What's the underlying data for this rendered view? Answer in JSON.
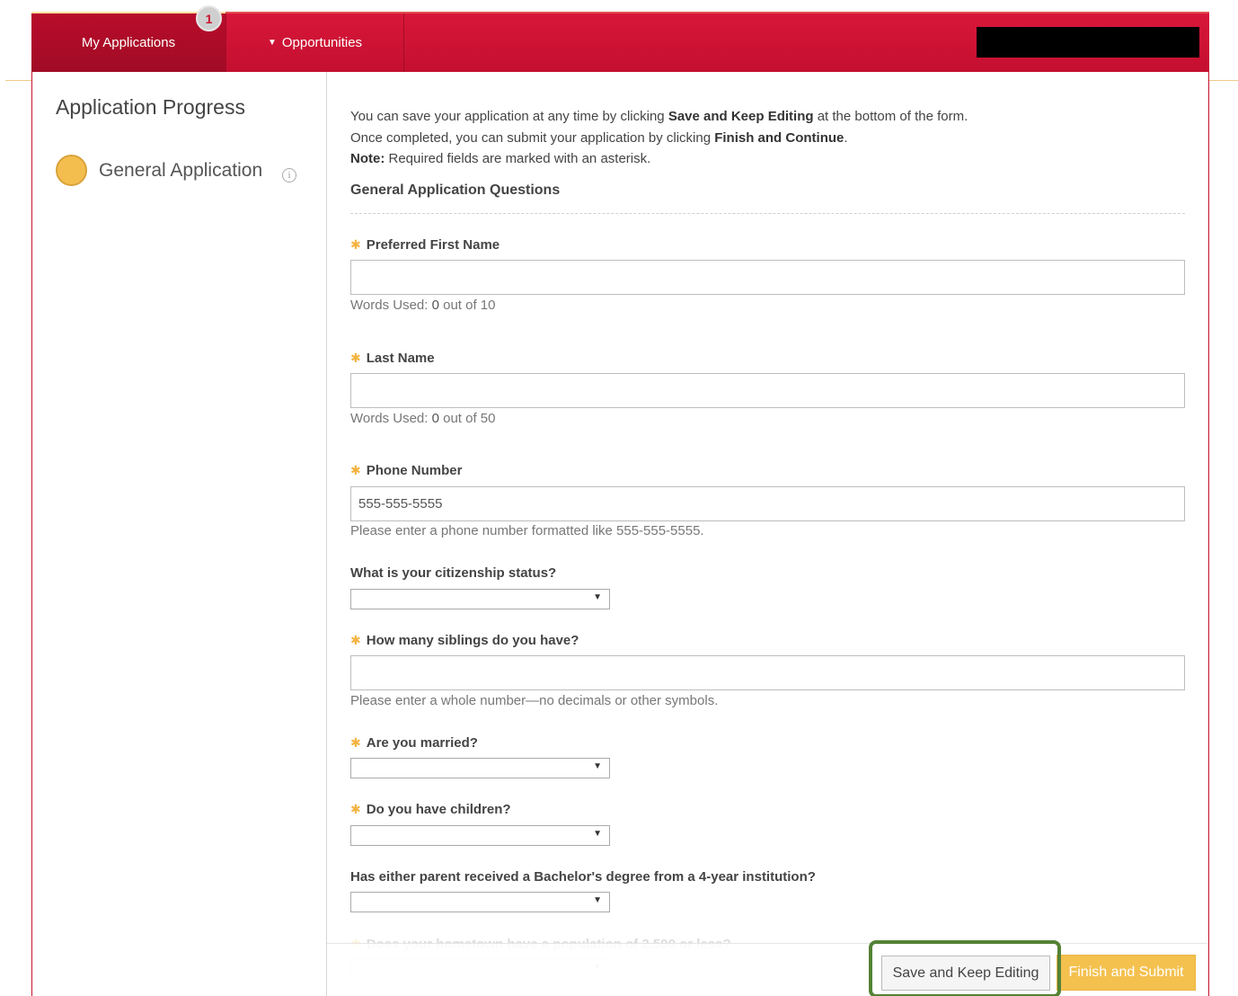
{
  "nav": {
    "my_applications": "My Applications",
    "badge_count": "1",
    "opportunities": "Opportunities"
  },
  "sidebar": {
    "title": "Application Progress",
    "step_label": "General Application",
    "info_glyph": "i"
  },
  "intro": {
    "line1_pre": "You can save your application at any time by clicking ",
    "line1_bold": "Save and Keep Editing",
    "line1_post": " at the bottom of the form.",
    "line2_pre": "Once completed, you can submit your application by clicking ",
    "line2_bold": "Finish and Continue",
    "line2_post": ".",
    "line3_bold": "Note:",
    "line3_post": " Required fields are marked with an asterisk."
  },
  "section_title": "General Application Questions",
  "star": "✱",
  "select_arrow": "▼",
  "questions": {
    "first_name": {
      "label": "Preferred First Name",
      "words_prefix": "Words Used: ",
      "words_used": "0",
      "words_suffix": " out of 10",
      "value": ""
    },
    "last_name": {
      "label": "Last Name",
      "words_prefix": "Words Used: ",
      "words_used": "0",
      "words_suffix": " out of 50",
      "value": ""
    },
    "phone": {
      "label": "Phone Number",
      "value": "555-555-5555",
      "help": "Please enter a phone number formatted like 555-555-5555."
    },
    "citizenship": {
      "label": "What is your citizenship status?",
      "selected": ""
    },
    "siblings": {
      "label": "How many siblings do you have?",
      "value": "",
      "help": "Please enter a whole number—no decimals or other symbols."
    },
    "married": {
      "label": "Are you married?",
      "selected": ""
    },
    "children": {
      "label": "Do you have children?",
      "selected": ""
    },
    "parent_degree": {
      "label": "Has either parent received a Bachelor's degree from a 4-year institution?",
      "selected": ""
    },
    "hometown": {
      "label": "Does your hometown have a population of 2,500 or less?",
      "selected": ""
    }
  },
  "footer": {
    "save_label": "Save and Keep Editing",
    "finish_label": "Finish and Submit"
  },
  "colors": {
    "brand_red": "#c8102e",
    "accent_gold": "#f4c14f",
    "highlight_green": "#548235"
  }
}
